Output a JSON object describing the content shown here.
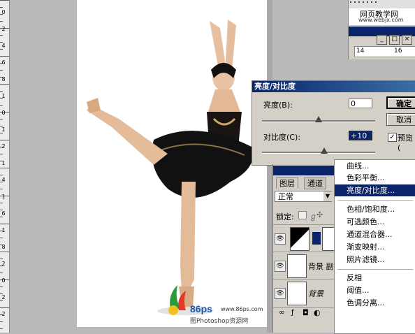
{
  "ruler_left": {
    "labels": [
      "0",
      "2",
      "4",
      "6",
      "8",
      "1",
      "0",
      "1",
      "2",
      "1",
      "4",
      "1",
      "6",
      "1",
      "8",
      "2",
      "0",
      "2",
      "2"
    ]
  },
  "mini_window": {
    "watermark_title": "网页教学网",
    "watermark_url": "www.webjx.com",
    "controls": [
      "_",
      "□",
      "×"
    ],
    "ruler_labels": [
      "14",
      "16"
    ]
  },
  "dialog": {
    "title": "亮度/对比度",
    "brightness_label": "亮度(B):",
    "brightness_value": "0",
    "contrast_label": "对比度(C):",
    "contrast_value": "+10",
    "ok_label": "确定",
    "cancel_label": "取消",
    "preview_label": "预览(",
    "preview_checked": "✓"
  },
  "layers_panel": {
    "tabs": [
      "图层",
      "通道"
    ],
    "blend_mode": "正常",
    "lock_label": "锁定:",
    "rows": [
      {
        "name": ""
      },
      {
        "name": "背景 副"
      },
      {
        "name": "背景"
      }
    ]
  },
  "menu": {
    "items": [
      "曲线...",
      "色彩平衡...",
      "亮度/对比度...",
      "色相/饱和度...",
      "可选颜色...",
      "通道混合器...",
      "渐变映射...",
      "照片滤镜...",
      "反相",
      "阈值...",
      "色调分离..."
    ],
    "active_index": 2
  },
  "watermark": {
    "logo_text": "86ps",
    "url": "www.86ps.com",
    "caption": "图Photoshop资源网"
  }
}
